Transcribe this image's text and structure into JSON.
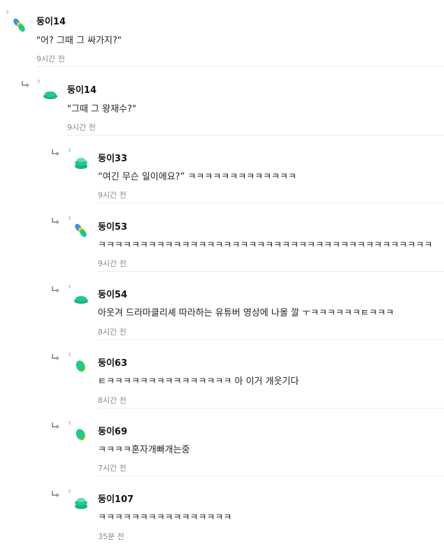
{
  "comments": [
    {
      "nick": "둥이14",
      "text": "\"어? 그때 그 싸가지?\"",
      "time": "9시간 전",
      "avatar": "blue-yellow-pill",
      "reply": false
    },
    {
      "nick": "둥이14",
      "text": "\"그때 그 왕재수?\"",
      "time": "9시간 전",
      "avatar": "green-disc",
      "reply": true
    },
    {
      "nick": "둥이33",
      "text": "“여긴 무슨 일이에요?” ㅋㅋㅋㅋㅋㅋㅋㅋㅋㅋㅋㅋㅋ",
      "time": "9시간 전",
      "avatar": "green-stack",
      "reply": true
    },
    {
      "nick": "둥이53",
      "text": "ㅋㅋㅋㅋㅋㅋㅋㅋㅋㅋㅋㅋㅋㅋㅋㅋㅋㅋㅋㅋㅋㅋㅋㅋㅋㅋㅋㅋㅋㅋㅋㅋㅋㅋㅋㅋㅋㅋㅋㅋ",
      "time": "9시간 전",
      "avatar": "blue-yellow-pill",
      "reply": true
    },
    {
      "nick": "둥이54",
      "text": "아웃겨 드라마클리셰 따라하는 유튜버 영상에 나올 깔 ㅜㅋㅋㅋㅋㅋㅋㅌㅋㅋㅋ",
      "time": "8시간 전",
      "avatar": "green-disc",
      "reply": true
    },
    {
      "nick": "둥이63",
      "text": "ㅌㅋㅋㅋㅋㅋㅋㅋㅋㅋㅋㅋㅋㅋㅋㅋ 아 이거 개웃기다",
      "time": "8시간 전",
      "avatar": "green-yellow-oval",
      "reply": true
    },
    {
      "nick": "둥이69",
      "text": "ㅋㅋㅋㅋ혼자개빠개는중",
      "time": "7시간 전",
      "avatar": "green-yellow-oval",
      "reply": true
    },
    {
      "nick": "둥이107",
      "text": "ㅋㅋㅋㅋㅋㅋㅋㅋㅋㅋㅋㅋㅋㅋㅋㅋ",
      "time": "35분 전",
      "avatar": "green-stack",
      "reply": true
    }
  ],
  "colors": {
    "green": "#21c98a",
    "blue": "#3d8ff0",
    "yellow": "#f4d21f",
    "meta": "#8a8a8a"
  },
  "icons": {
    "reply": "reply-arrow-icon",
    "placeholder": "image-placeholder-icon"
  }
}
